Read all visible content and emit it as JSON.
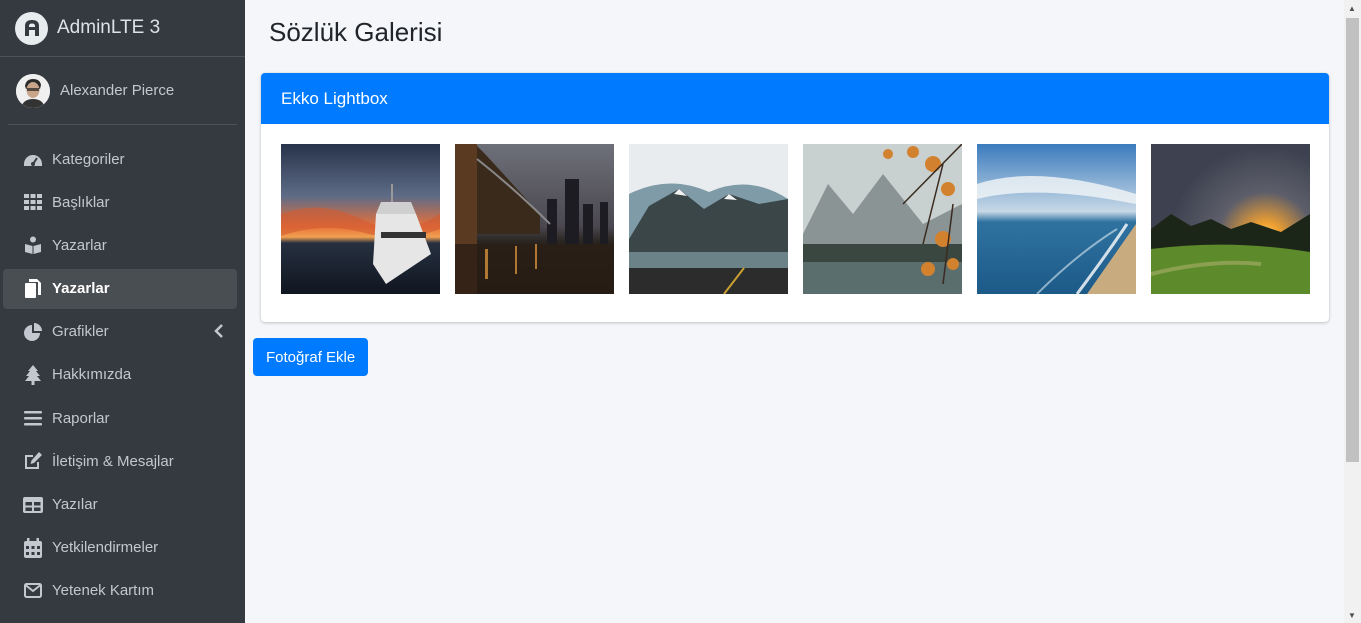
{
  "brand": {
    "name": "AdminLTE 3"
  },
  "user": {
    "name": "Alexander Pierce"
  },
  "nav": [
    {
      "label": "Kategoriler",
      "icon": "tachometer-icon"
    },
    {
      "label": "Başlıklar",
      "icon": "grid-icon"
    },
    {
      "label": "Yazarlar",
      "icon": "book-reader-icon"
    },
    {
      "label": "Yazarlar",
      "icon": "copy-icon",
      "active": true
    },
    {
      "label": "Grafikler",
      "icon": "pie-chart-icon",
      "has_submenu": true
    },
    {
      "label": "Hakkımızda",
      "icon": "tree-icon"
    },
    {
      "label": "Raporlar",
      "icon": "bars-icon"
    },
    {
      "label": "İletişim & Mesajlar",
      "icon": "edit-icon"
    },
    {
      "label": "Yazılar",
      "icon": "table-icon"
    },
    {
      "label": "Yetkilendirmeler",
      "icon": "calendar-icon"
    },
    {
      "label": "Yetenek Kartım",
      "icon": "envelope-icon"
    }
  ],
  "page": {
    "title": "Sözlük Galerisi"
  },
  "card": {
    "title": "Ekko Lightbox"
  },
  "gallery": [
    {
      "subject": "boat at sunset"
    },
    {
      "subject": "bridge city night"
    },
    {
      "subject": "snowy mountains lake"
    },
    {
      "subject": "autumn leaves lake"
    },
    {
      "subject": "ocean beach"
    },
    {
      "subject": "sunset field"
    }
  ],
  "actions": {
    "add_photo": "Fotoğraf Ekle"
  },
  "colors": {
    "primary": "#007bff",
    "sidebar": "#343a40",
    "background": "#f4f6f9"
  }
}
